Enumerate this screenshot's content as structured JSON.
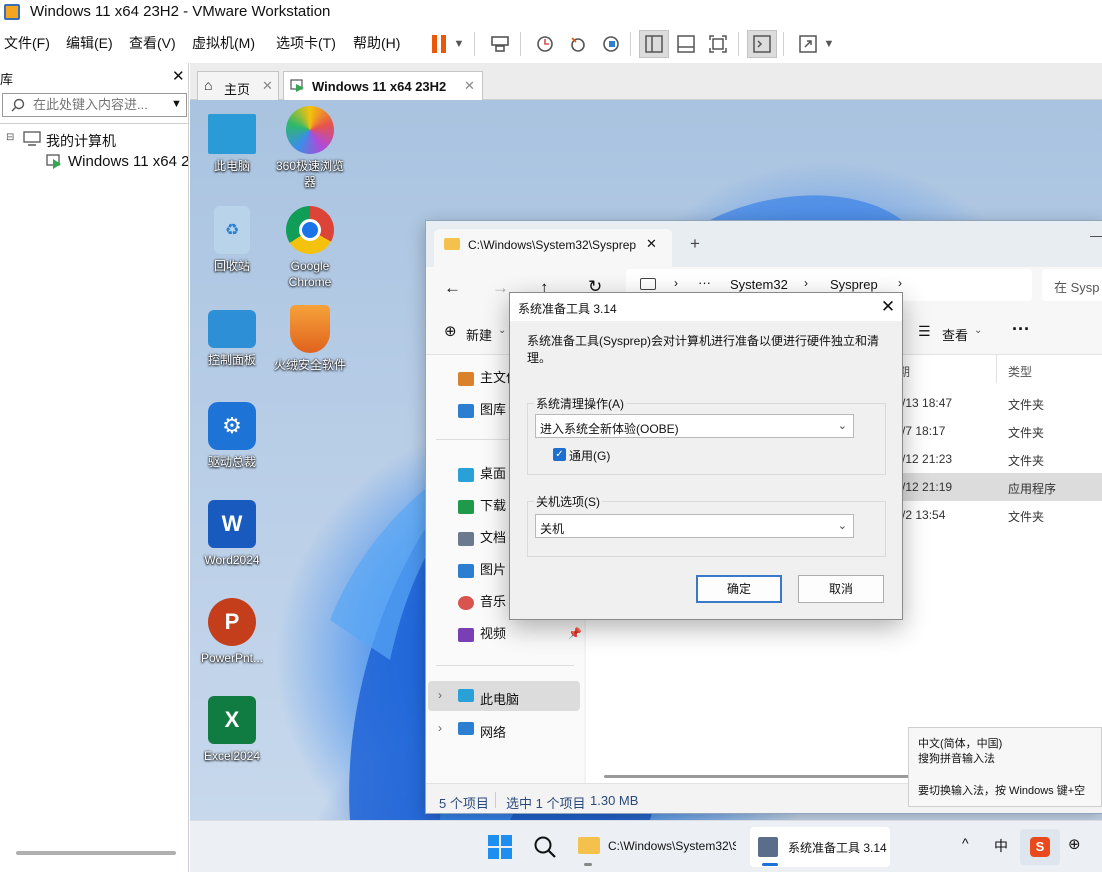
{
  "window": {
    "title": "Windows 11 x64 23H2 - VMware Workstation"
  },
  "menu": [
    "文件(F)",
    "编辑(E)",
    "查看(V)",
    "虚拟机(M)",
    "选项卡(T)",
    "帮助(H)"
  ],
  "library": {
    "title": "库",
    "search_placeholder": "在此处键入内容进...",
    "tree": {
      "root": "我的计算机",
      "vm": "Windows 11 x64 23H2"
    }
  },
  "vm_tabs": [
    {
      "label": "主页"
    },
    {
      "label": "Windows 11 x64 23H2"
    }
  ],
  "desktop_icons": [
    {
      "label": "此电脑",
      "icon": "monitor-icon",
      "color": "#2b9bd8"
    },
    {
      "label": "360极速浏览器",
      "icon": "browser-360-icon",
      "color": "#e7544a"
    },
    {
      "label": "回收站",
      "icon": "recycle-bin-icon",
      "color": "#8fb8d8"
    },
    {
      "label": "Google Chrome",
      "icon": "chrome-icon",
      "color": "#1a73e8"
    },
    {
      "label": "控制面板",
      "icon": "control-panel-icon",
      "color": "#2d8fd6"
    },
    {
      "label": "火绒安全软件",
      "icon": "huorong-icon",
      "color": "#f08a24"
    },
    {
      "label": "驱动总裁",
      "icon": "driver-icon",
      "color": "#1e73d6"
    },
    {
      "label": "Word2024",
      "icon": "word-icon",
      "color": "#185abd"
    },
    {
      "label": "PowerPnt...",
      "icon": "powerpoint-icon",
      "color": "#c43e1c"
    },
    {
      "label": "Excel2024",
      "icon": "excel-icon",
      "color": "#107c41"
    }
  ],
  "explorer": {
    "tab_title": "C:\\Windows\\System32\\Sysprep",
    "breadcrumb": [
      "System32",
      "Sysprep"
    ],
    "search_placeholder": "在 Sysp",
    "new_label": "新建",
    "view_label": "查看",
    "side_items": [
      {
        "label": "主文件夹",
        "icon": "home-icon",
        "color": "#d9822b"
      },
      {
        "label": "图库",
        "icon": "gallery-icon",
        "color": "#2b7fd0"
      },
      {
        "label": "桌面",
        "icon": "desktop-icon",
        "color": "#2aa0d8"
      },
      {
        "label": "下载",
        "icon": "download-icon",
        "color": "#1f9a4a"
      },
      {
        "label": "文档",
        "icon": "document-icon",
        "color": "#6b7a8f"
      },
      {
        "label": "图片",
        "icon": "pictures-icon",
        "color": "#2b7fd0"
      },
      {
        "label": "音乐",
        "icon": "music-icon",
        "color": "#d9534f"
      },
      {
        "label": "视频",
        "icon": "video-icon",
        "color": "#7b3fb5"
      },
      {
        "label": "此电脑",
        "icon": "pc-icon",
        "color": "#2aa0d8"
      },
      {
        "label": "网络",
        "icon": "network-icon",
        "color": "#2b7fd0"
      }
    ],
    "columns": {
      "date": "期",
      "type": "类型"
    },
    "rows": [
      {
        "date": "/13 18:47",
        "type": "文件夹",
        "selected": false
      },
      {
        "date": "/7 18:17",
        "type": "文件夹",
        "selected": false
      },
      {
        "date": "/12 21:23",
        "type": "文件夹",
        "selected": false
      },
      {
        "date": "/12 21:19",
        "type": "应用程序",
        "selected": true
      },
      {
        "date": "/2 13:54",
        "type": "文件夹",
        "selected": false
      }
    ],
    "status": {
      "count": "5 个项目",
      "selected": "选中 1 个项目",
      "size": "1.30 MB"
    }
  },
  "sysprep": {
    "title": "系统准备工具 3.14",
    "description": "系统准备工具(Sysprep)会对计算机进行准备以便进行硬件独立和清理。",
    "cleanup_group": "系统清理操作(A)",
    "cleanup_value": "进入系统全新体验(OOBE)",
    "generalize_label": "通用(G)",
    "generalize_checked": true,
    "shutdown_group": "关机选项(S)",
    "shutdown_value": "关机",
    "ok": "确定",
    "cancel": "取消"
  },
  "ime_popup": {
    "line1": "中文(简体，中国)",
    "line2": "搜狗拼音输入法",
    "line3": "要切换输入法，按 Windows 键+空"
  },
  "taskbar": {
    "explorer_label": "C:\\Windows\\System32\\S",
    "sysprep_label": "系统准备工具 3.14",
    "ime_mode": "中"
  }
}
